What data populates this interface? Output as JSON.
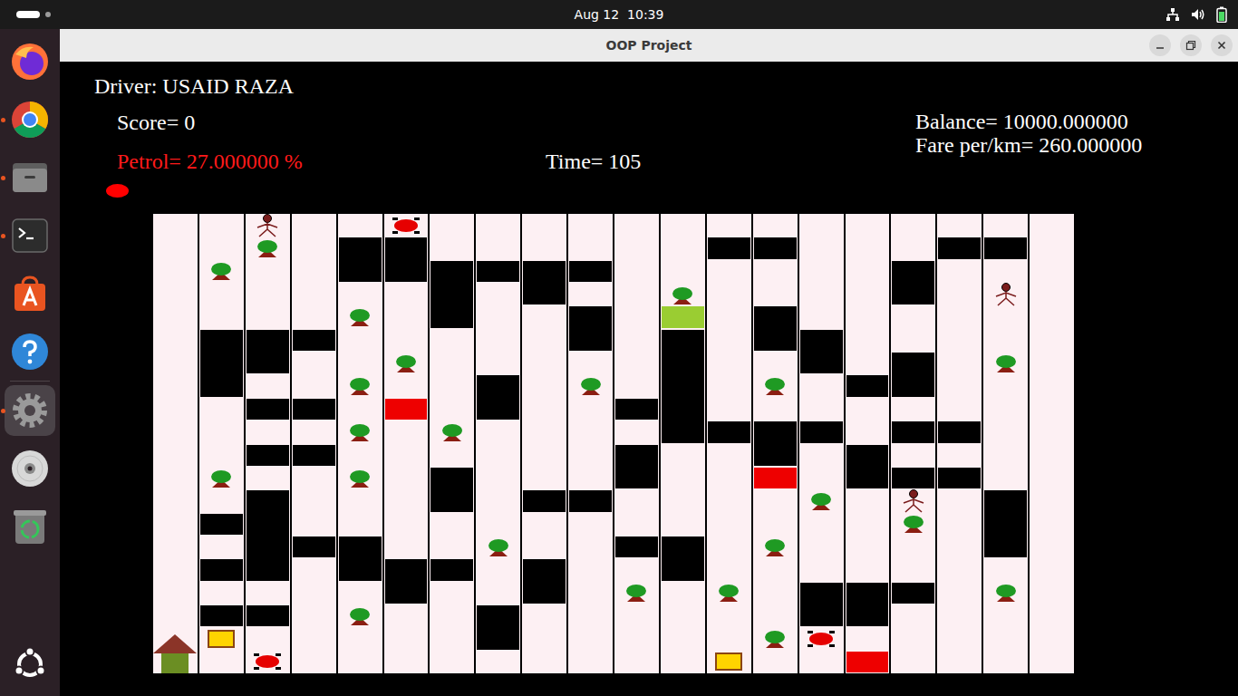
{
  "topbar": {
    "clock": "Aug 12  10:39"
  },
  "dock": {
    "items": [
      {
        "kind": "firefox",
        "running": false,
        "selected": false
      },
      {
        "kind": "chrome",
        "running": true,
        "selected": false
      },
      {
        "kind": "files",
        "running": true,
        "selected": false
      },
      {
        "kind": "terminal",
        "running": true,
        "selected": false
      },
      {
        "kind": "appcenter",
        "running": false,
        "selected": false
      },
      {
        "kind": "help",
        "running": false,
        "selected": false
      },
      {
        "kind": "settings",
        "running": true,
        "selected": true
      },
      {
        "kind": "disc",
        "running": false,
        "selected": false
      },
      {
        "kind": "trash",
        "running": false,
        "selected": false
      }
    ]
  },
  "window": {
    "title": "OOP Project"
  },
  "hud": {
    "driver": "Driver: USAID RAZA",
    "score": "Score= 0",
    "petrol": {
      "text": "Petrol= 27.000000 %",
      "low": true
    },
    "time": "Time= 105",
    "balance": "Balance= 10000.000000",
    "fare": "Fare per/km= 260.000000"
  },
  "board": {
    "items": [
      {
        "kind": "home",
        "col": 0,
        "row": 18,
        "span": 2
      },
      {
        "kind": "tree",
        "col": 1,
        "row": 2,
        "span": 1
      },
      {
        "kind": "building",
        "col": 1,
        "row": 5,
        "span": 3
      },
      {
        "kind": "tree",
        "col": 1,
        "row": 11,
        "span": 1
      },
      {
        "kind": "building",
        "col": 1,
        "row": 13,
        "span": 1
      },
      {
        "kind": "building",
        "col": 1,
        "row": 15,
        "span": 1
      },
      {
        "kind": "building",
        "col": 1,
        "row": 17,
        "span": 1
      },
      {
        "kind": "fuel",
        "col": 1,
        "row": 18,
        "span": 1
      },
      {
        "kind": "person",
        "col": 2,
        "row": 0,
        "span": 1
      },
      {
        "kind": "tree",
        "col": 2,
        "row": 1,
        "span": 1
      },
      {
        "kind": "building",
        "col": 2,
        "row": 5,
        "span": 2
      },
      {
        "kind": "building",
        "col": 2,
        "row": 8,
        "span": 1
      },
      {
        "kind": "building",
        "col": 2,
        "row": 10,
        "span": 1
      },
      {
        "kind": "building",
        "col": 2,
        "row": 12,
        "span": 4
      },
      {
        "kind": "building",
        "col": 2,
        "row": 17,
        "span": 1
      },
      {
        "kind": "car",
        "col": 2,
        "row": 19,
        "span": 1
      },
      {
        "kind": "building",
        "col": 3,
        "row": 5,
        "span": 1
      },
      {
        "kind": "building",
        "col": 3,
        "row": 8,
        "span": 1
      },
      {
        "kind": "building",
        "col": 3,
        "row": 10,
        "span": 1
      },
      {
        "kind": "building",
        "col": 3,
        "row": 14,
        "span": 1
      },
      {
        "kind": "building",
        "col": 4,
        "row": 1,
        "span": 2
      },
      {
        "kind": "tree",
        "col": 4,
        "row": 4,
        "span": 1
      },
      {
        "kind": "tree",
        "col": 4,
        "row": 7,
        "span": 1
      },
      {
        "kind": "tree",
        "col": 4,
        "row": 9,
        "span": 1
      },
      {
        "kind": "tree",
        "col": 4,
        "row": 11,
        "span": 1
      },
      {
        "kind": "building",
        "col": 4,
        "row": 14,
        "span": 2
      },
      {
        "kind": "tree",
        "col": 4,
        "row": 17,
        "span": 1
      },
      {
        "kind": "car",
        "col": 5,
        "row": 0,
        "span": 1
      },
      {
        "kind": "building",
        "col": 5,
        "row": 1,
        "span": 2
      },
      {
        "kind": "tree",
        "col": 5,
        "row": 6,
        "span": 1
      },
      {
        "kind": "blocked",
        "col": 5,
        "row": 8,
        "span": 1
      },
      {
        "kind": "building",
        "col": 5,
        "row": 15,
        "span": 2
      },
      {
        "kind": "building",
        "col": 6,
        "row": 2,
        "span": 3
      },
      {
        "kind": "tree",
        "col": 6,
        "row": 9,
        "span": 1
      },
      {
        "kind": "building",
        "col": 6,
        "row": 11,
        "span": 2
      },
      {
        "kind": "building",
        "col": 6,
        "row": 15,
        "span": 1
      },
      {
        "kind": "building",
        "col": 7,
        "row": 2,
        "span": 1
      },
      {
        "kind": "building",
        "col": 7,
        "row": 7,
        "span": 2
      },
      {
        "kind": "tree",
        "col": 7,
        "row": 14,
        "span": 1
      },
      {
        "kind": "building",
        "col": 7,
        "row": 17,
        "span": 2
      },
      {
        "kind": "building",
        "col": 8,
        "row": 2,
        "span": 2
      },
      {
        "kind": "building",
        "col": 8,
        "row": 12,
        "span": 1
      },
      {
        "kind": "building",
        "col": 8,
        "row": 15,
        "span": 2
      },
      {
        "kind": "building",
        "col": 9,
        "row": 2,
        "span": 1
      },
      {
        "kind": "building",
        "col": 9,
        "row": 4,
        "span": 2
      },
      {
        "kind": "tree",
        "col": 9,
        "row": 7,
        "span": 1
      },
      {
        "kind": "building",
        "col": 9,
        "row": 12,
        "span": 1
      },
      {
        "kind": "building",
        "col": 10,
        "row": 8,
        "span": 1
      },
      {
        "kind": "building",
        "col": 10,
        "row": 10,
        "span": 2
      },
      {
        "kind": "building",
        "col": 10,
        "row": 14,
        "span": 1
      },
      {
        "kind": "tree",
        "col": 10,
        "row": 16,
        "span": 1
      },
      {
        "kind": "tree",
        "col": 11,
        "row": 3,
        "span": 1
      },
      {
        "kind": "destination",
        "col": 11,
        "row": 4,
        "span": 1
      },
      {
        "kind": "building",
        "col": 11,
        "row": 5,
        "span": 5
      },
      {
        "kind": "building",
        "col": 11,
        "row": 14,
        "span": 2
      },
      {
        "kind": "building",
        "col": 12,
        "row": 1,
        "span": 1
      },
      {
        "kind": "building",
        "col": 12,
        "row": 9,
        "span": 1
      },
      {
        "kind": "tree",
        "col": 12,
        "row": 16,
        "span": 1
      },
      {
        "kind": "fuel",
        "col": 12,
        "row": 19,
        "span": 1
      },
      {
        "kind": "building",
        "col": 13,
        "row": 1,
        "span": 1
      },
      {
        "kind": "building",
        "col": 13,
        "row": 4,
        "span": 2
      },
      {
        "kind": "tree",
        "col": 13,
        "row": 7,
        "span": 1
      },
      {
        "kind": "building",
        "col": 13,
        "row": 9,
        "span": 2
      },
      {
        "kind": "blocked",
        "col": 13,
        "row": 11,
        "span": 1
      },
      {
        "kind": "tree",
        "col": 13,
        "row": 14,
        "span": 1
      },
      {
        "kind": "tree",
        "col": 13,
        "row": 18,
        "span": 1
      },
      {
        "kind": "building",
        "col": 14,
        "row": 5,
        "span": 2
      },
      {
        "kind": "building",
        "col": 14,
        "row": 9,
        "span": 1
      },
      {
        "kind": "tree",
        "col": 14,
        "row": 12,
        "span": 1
      },
      {
        "kind": "building",
        "col": 14,
        "row": 16,
        "span": 2
      },
      {
        "kind": "car",
        "col": 14,
        "row": 18,
        "span": 1
      },
      {
        "kind": "building",
        "col": 15,
        "row": 7,
        "span": 1
      },
      {
        "kind": "building",
        "col": 15,
        "row": 10,
        "span": 2
      },
      {
        "kind": "building",
        "col": 15,
        "row": 16,
        "span": 2
      },
      {
        "kind": "blocked",
        "col": 15,
        "row": 19,
        "span": 1
      },
      {
        "kind": "building",
        "col": 16,
        "row": 2,
        "span": 2
      },
      {
        "kind": "building",
        "col": 16,
        "row": 6,
        "span": 2
      },
      {
        "kind": "building",
        "col": 16,
        "row": 9,
        "span": 1
      },
      {
        "kind": "building",
        "col": 16,
        "row": 11,
        "span": 1
      },
      {
        "kind": "person",
        "col": 16,
        "row": 12,
        "span": 1
      },
      {
        "kind": "tree",
        "col": 16,
        "row": 13,
        "span": 1
      },
      {
        "kind": "building",
        "col": 16,
        "row": 16,
        "span": 1
      },
      {
        "kind": "building",
        "col": 17,
        "row": 1,
        "span": 1
      },
      {
        "kind": "building",
        "col": 17,
        "row": 9,
        "span": 1
      },
      {
        "kind": "building",
        "col": 17,
        "row": 11,
        "span": 1
      },
      {
        "kind": "building",
        "col": 18,
        "row": 1,
        "span": 1
      },
      {
        "kind": "person",
        "col": 18,
        "row": 3,
        "span": 1
      },
      {
        "kind": "tree",
        "col": 18,
        "row": 6,
        "span": 1
      },
      {
        "kind": "building",
        "col": 18,
        "row": 12,
        "span": 3
      },
      {
        "kind": "tree",
        "col": 18,
        "row": 16,
        "span": 1
      }
    ]
  }
}
